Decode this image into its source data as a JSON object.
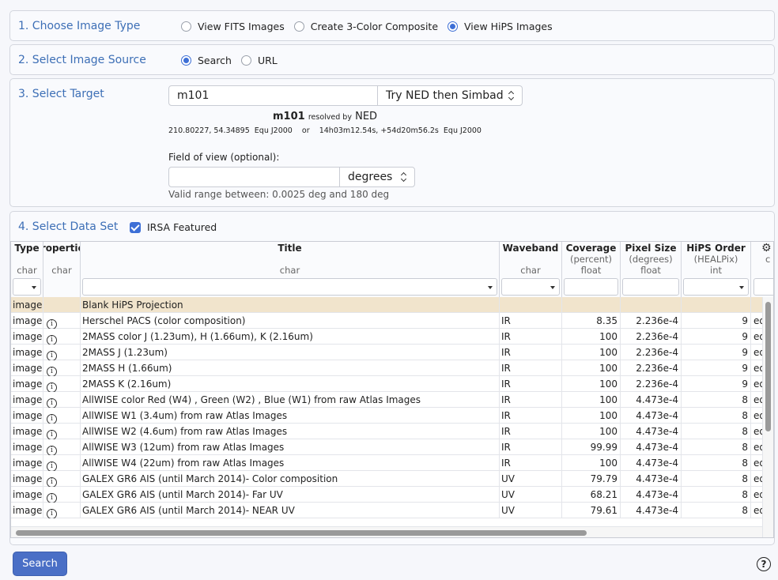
{
  "step1": {
    "title": "1. Choose Image Type",
    "options": [
      "View FITS Images",
      "Create 3-Color Composite",
      "View HiPS Images"
    ],
    "selected": 2
  },
  "step2": {
    "title": "2. Select Image Source",
    "options": [
      "Search",
      "URL"
    ],
    "selected": 0
  },
  "step3": {
    "title": "3. Select Target",
    "target_value": "m101",
    "resolver": "Try NED then Simbad",
    "resolved_name": "m101",
    "resolved_by": "resolved by",
    "resolver_name": "NED",
    "coords": "210.80227, 54.34895  Equ J2000    or    14h03m12.54s, +54d20m56.2s  Equ J2000",
    "fov_label": "Field of view (optional):",
    "fov_value": "",
    "fov_units": "degrees",
    "fov_hint": "Valid range between: 0.0025 deg and 180 deg"
  },
  "step4": {
    "title": "4. Select Data Set",
    "irsa_featured_label": "IRSA Featured",
    "irsa_featured_checked": true
  },
  "table": {
    "columns": [
      {
        "name": "Type",
        "units": "",
        "type": "char"
      },
      {
        "name": "Properties",
        "units": "",
        "type": "char"
      },
      {
        "name": "Title",
        "units": "",
        "type": "char"
      },
      {
        "name": "Waveband",
        "units": "",
        "type": "char"
      },
      {
        "name": "Coverage",
        "units": "(percent)",
        "type": "float"
      },
      {
        "name": "Pixel Size",
        "units": "(degrees)",
        "type": "float"
      },
      {
        "name": "HiPS Order",
        "units": "(HEALPix)",
        "type": "int"
      },
      {
        "name": "",
        "units": "",
        "type": "c"
      }
    ],
    "rows": [
      {
        "type": "image",
        "info": false,
        "title": "Blank HiPS Projection",
        "waveband": "",
        "coverage": "",
        "pixel": "",
        "order": "",
        "extra": "",
        "selected": true
      },
      {
        "type": "image",
        "info": true,
        "title": "Herschel PACS (color composition)",
        "waveband": "IR",
        "coverage": "8.35",
        "pixel": "2.236e-4",
        "order": "9",
        "extra": "eq"
      },
      {
        "type": "image",
        "info": true,
        "title": "2MASS color J (1.23um), H (1.66um), K (2.16um)",
        "waveband": "IR",
        "coverage": "100",
        "pixel": "2.236e-4",
        "order": "9",
        "extra": "eq"
      },
      {
        "type": "image",
        "info": true,
        "title": "2MASS J (1.23um)",
        "waveband": "IR",
        "coverage": "100",
        "pixel": "2.236e-4",
        "order": "9",
        "extra": "eq"
      },
      {
        "type": "image",
        "info": true,
        "title": "2MASS H (1.66um)",
        "waveband": "IR",
        "coverage": "100",
        "pixel": "2.236e-4",
        "order": "9",
        "extra": "eq"
      },
      {
        "type": "image",
        "info": true,
        "title": "2MASS K (2.16um)",
        "waveband": "IR",
        "coverage": "100",
        "pixel": "2.236e-4",
        "order": "9",
        "extra": "eq"
      },
      {
        "type": "image",
        "info": true,
        "title": "AllWISE color Red (W4) , Green (W2) , Blue (W1) from raw Atlas Images",
        "waveband": "IR",
        "coverage": "100",
        "pixel": "4.473e-4",
        "order": "8",
        "extra": "eq"
      },
      {
        "type": "image",
        "info": true,
        "title": "AllWISE W1 (3.4um) from raw Atlas Images",
        "waveband": "IR",
        "coverage": "100",
        "pixel": "4.473e-4",
        "order": "8",
        "extra": "eq"
      },
      {
        "type": "image",
        "info": true,
        "title": "AllWISE W2 (4.6um) from raw Atlas Images",
        "waveband": "IR",
        "coverage": "100",
        "pixel": "4.473e-4",
        "order": "8",
        "extra": "eq"
      },
      {
        "type": "image",
        "info": true,
        "title": "AllWISE W3 (12um) from raw Atlas Images",
        "waveband": "IR",
        "coverage": "99.99",
        "pixel": "4.473e-4",
        "order": "8",
        "extra": "eq"
      },
      {
        "type": "image",
        "info": true,
        "title": "AllWISE W4 (22um) from raw Atlas Images",
        "waveband": "IR",
        "coverage": "100",
        "pixel": "4.473e-4",
        "order": "8",
        "extra": "eq"
      },
      {
        "type": "image",
        "info": true,
        "title": "GALEX GR6 AIS (until March 2014)- Color composition",
        "waveband": "UV",
        "coverage": "79.79",
        "pixel": "4.473e-4",
        "order": "8",
        "extra": "eq"
      },
      {
        "type": "image",
        "info": true,
        "title": "GALEX GR6 AIS (until March 2014)- Far UV",
        "waveband": "UV",
        "coverage": "68.21",
        "pixel": "4.473e-4",
        "order": "8",
        "extra": "eq"
      },
      {
        "type": "image",
        "info": true,
        "title": "GALEX GR6 AIS (until March 2014)- NEAR UV",
        "waveband": "UV",
        "coverage": "79.61",
        "pixel": "4.473e-4",
        "order": "8",
        "extra": "eq"
      }
    ]
  },
  "search_label": "Search",
  "help_label": "?"
}
